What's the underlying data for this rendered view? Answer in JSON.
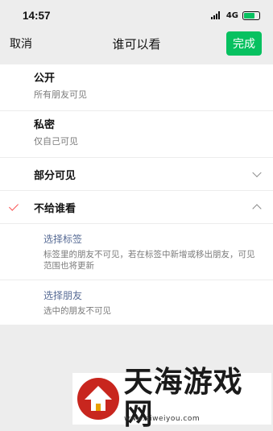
{
  "status": {
    "time": "14:57",
    "network": "4G"
  },
  "nav": {
    "cancel": "取消",
    "title": "谁可以看",
    "done": "完成"
  },
  "options": [
    {
      "title": "公开",
      "subtitle": "所有朋友可见"
    },
    {
      "title": "私密",
      "subtitle": "仅自己可见"
    },
    {
      "title": "部分可见"
    },
    {
      "title": "不给谁看",
      "selected": true
    }
  ],
  "sub_options": [
    {
      "title": "选择标签",
      "desc": "标签里的朋友不可见，若在标签中新增或移出朋友，可见范围也将更新"
    },
    {
      "title": "选择朋友",
      "desc": "选中的朋友不可见"
    }
  ],
  "watermark": {
    "brand": "天海游戏网",
    "url": "www.aiweiyou.com"
  },
  "colors": {
    "accent": "#07c160",
    "link": "#576b95",
    "check": "#fa5151"
  }
}
